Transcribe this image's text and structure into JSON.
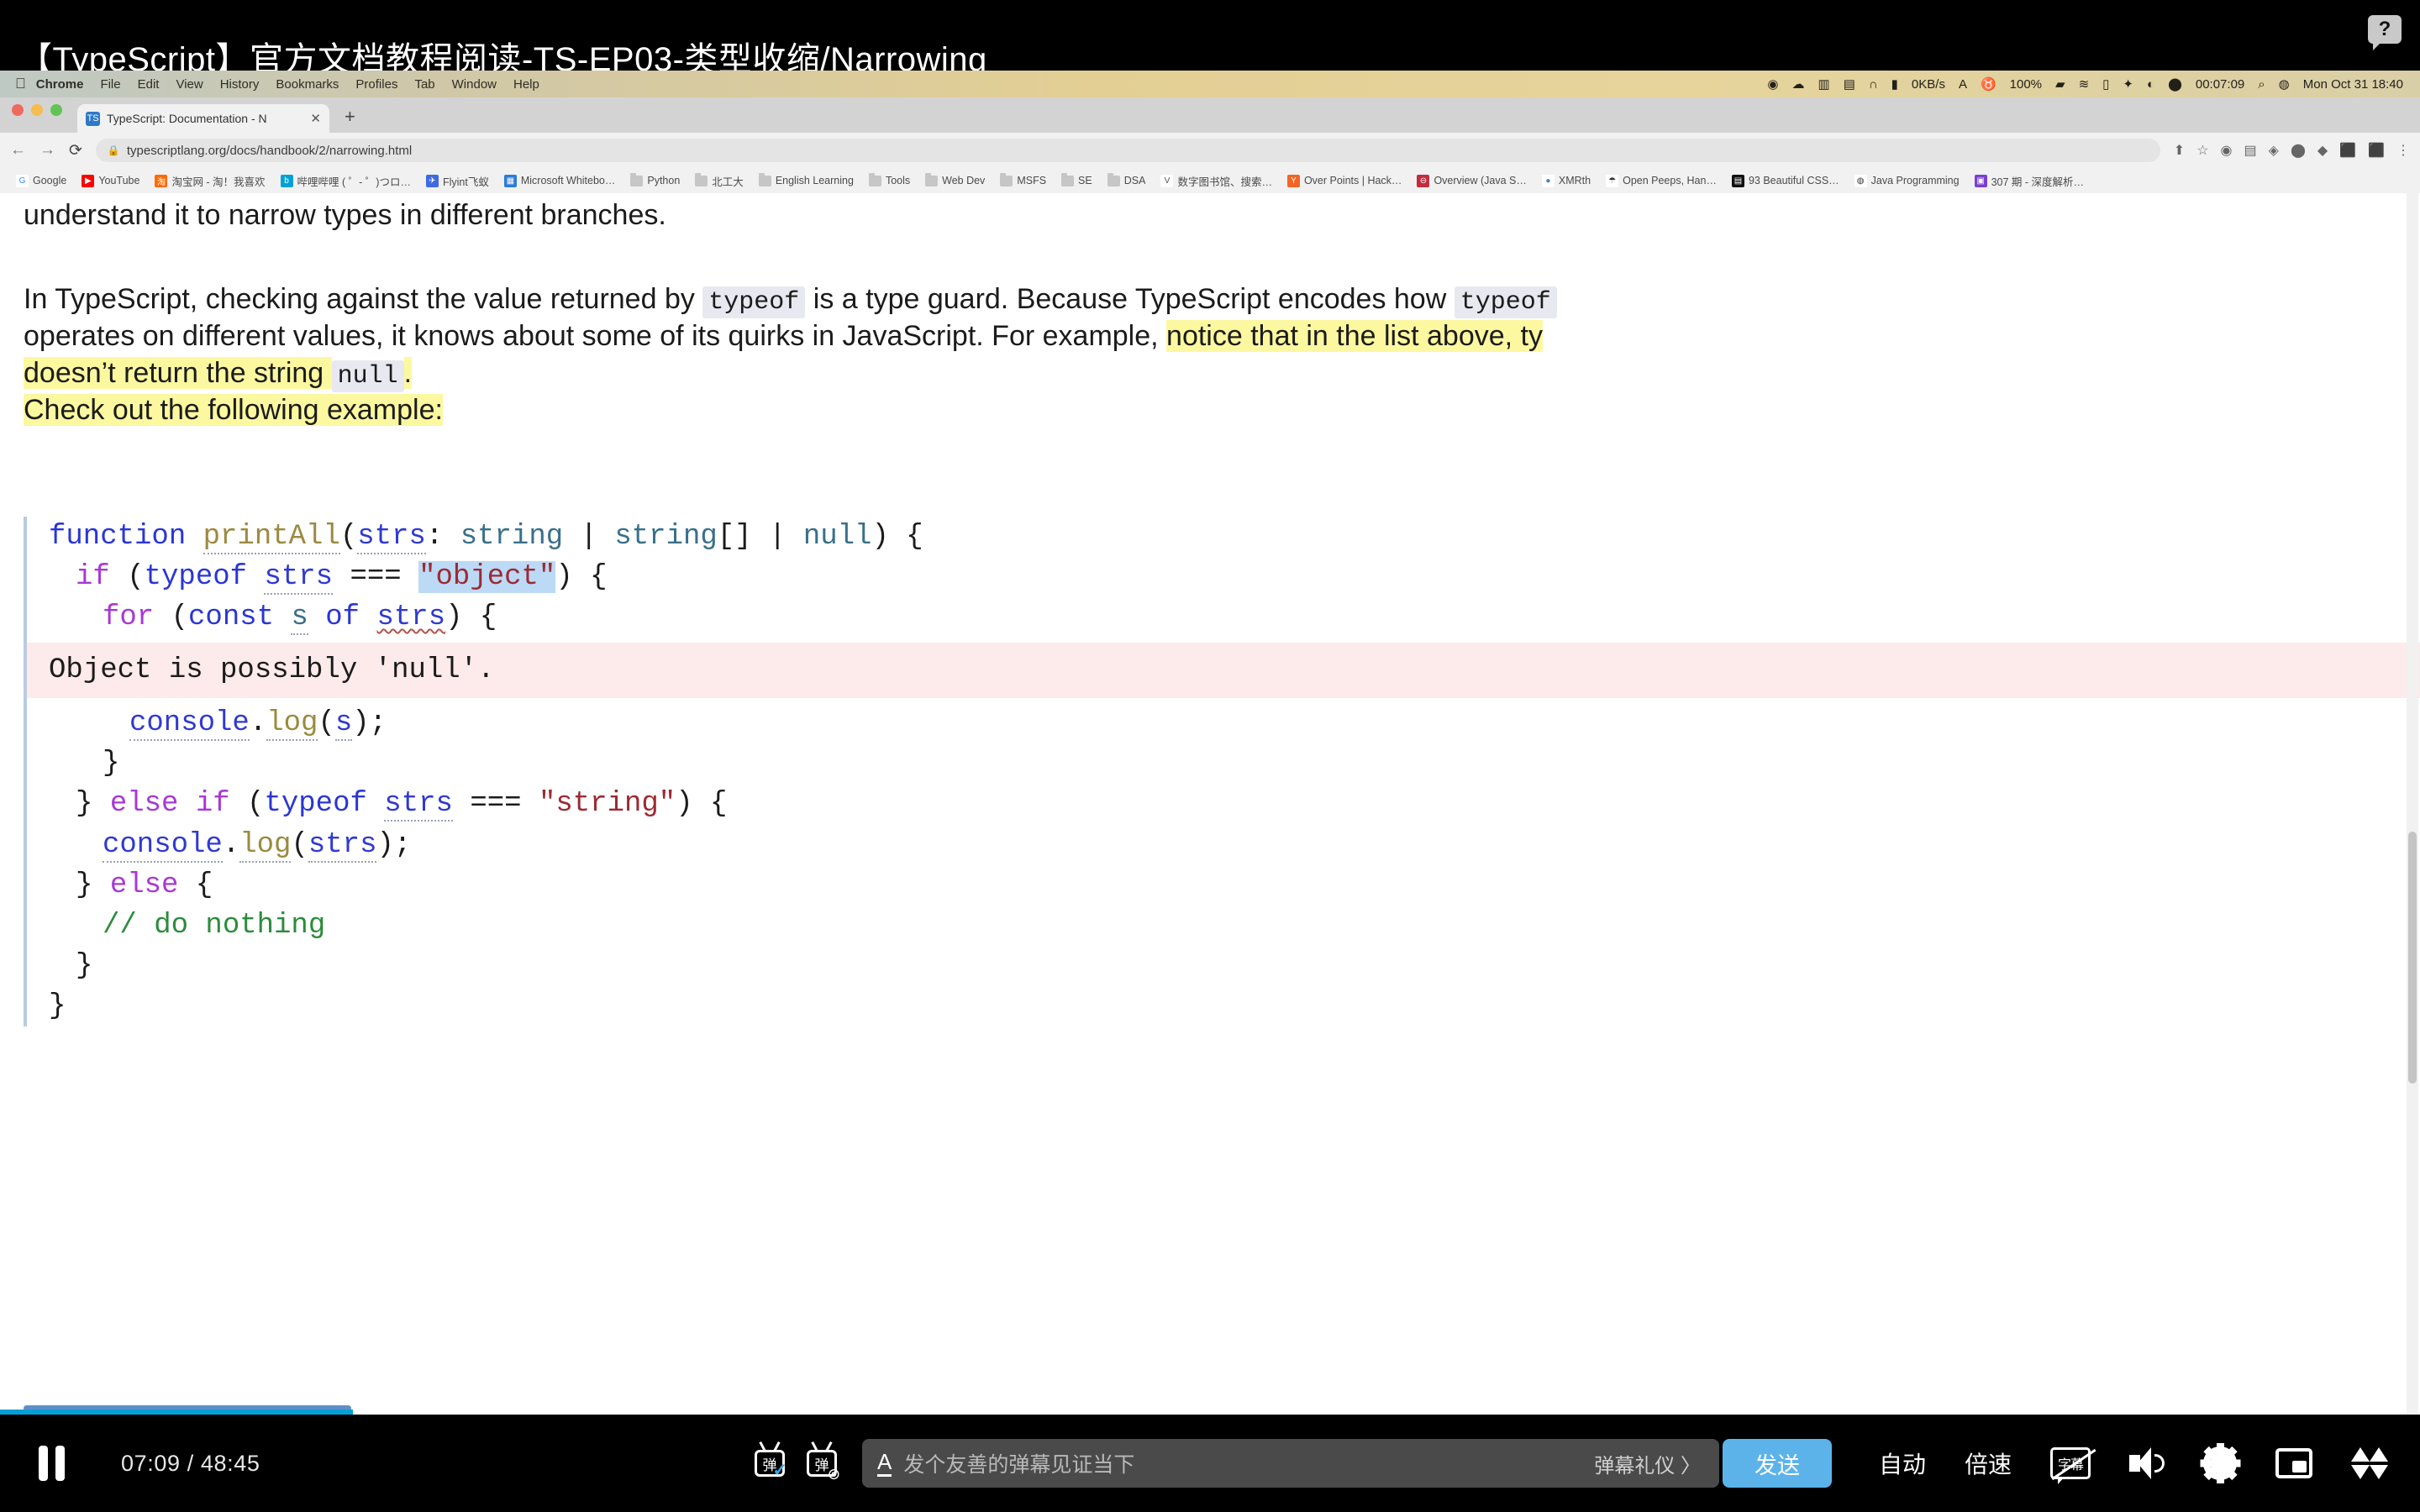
{
  "video": {
    "title": "【TypeScript】官方文档教程阅读-TS-EP03-类型收缩/Narrowing",
    "help_badge": "?",
    "current_time": "07:09",
    "duration": "48:45",
    "progress_percent": 14.6
  },
  "macos_menubar": {
    "apple": "",
    "items": [
      "Chrome",
      "File",
      "Edit",
      "View",
      "History",
      "Bookmarks",
      "Profiles",
      "Tab",
      "Window",
      "Help"
    ],
    "status_items": [
      {
        "name": "dropbox-icon",
        "glyph": "◉"
      },
      {
        "name": "cloud-icon",
        "glyph": "☁"
      },
      {
        "name": "equalizer-icon",
        "glyph": "▥"
      },
      {
        "name": "calendar-icon",
        "glyph": "▤"
      },
      {
        "name": "headphone-icon",
        "glyph": "∩"
      },
      {
        "name": "battery-monitor-icon",
        "glyph": "▮"
      },
      {
        "name": "network-speed-icon",
        "glyph": "0KB/s"
      },
      {
        "name": "a-letter-icon",
        "glyph": "A"
      },
      {
        "name": "fork-knife-icon",
        "glyph": "♉"
      },
      {
        "name": "battery-percent",
        "glyph": "100%"
      },
      {
        "name": "battery-icon",
        "glyph": "▰"
      },
      {
        "name": "wifi-icon",
        "glyph": "≋"
      },
      {
        "name": "control-center-icon",
        "glyph": "▯"
      },
      {
        "name": "bluetooth-icon",
        "glyph": "✦"
      },
      {
        "name": "moon-icon",
        "glyph": "◐"
      },
      {
        "name": "record-icon",
        "glyph": "⬤"
      },
      {
        "name": "screen-record-timer",
        "glyph": "00:07:09"
      },
      {
        "name": "spotlight-search-icon",
        "glyph": "⌕"
      },
      {
        "name": "siri-icon",
        "glyph": "◍"
      },
      {
        "name": "clock-datetime",
        "glyph": "Mon Oct 31  18:40"
      }
    ]
  },
  "browser": {
    "tab": {
      "favicon": "TS",
      "title": "TypeScript: Documentation - N",
      "close": "✕"
    },
    "new_tab_label": "+",
    "nav": {
      "back": "←",
      "forward": "→",
      "reload": "⟳"
    },
    "url": "typescriptlang.org/docs/handbook/2/narrowing.html",
    "lock_icon": "🔒",
    "omnibar_right": [
      "⬆",
      "☆",
      "◉",
      "▤",
      "◈",
      "⬤",
      "◆",
      "⬛",
      "⬛",
      "⋮"
    ],
    "bookmarks": [
      {
        "label": "Google",
        "icon": "G",
        "color": "#ffffff",
        "fg": "#4285f4"
      },
      {
        "label": "YouTube",
        "icon": "▶",
        "color": "#ff0000",
        "fg": "#ffffff"
      },
      {
        "label": "淘宝网 - 淘！我喜欢",
        "icon": "淘",
        "color": "#ff6a00",
        "fg": "#ffffff"
      },
      {
        "label": "哔哩哔哩 ( ゜- ゜)つロ…",
        "icon": "b",
        "color": "#00a1d6",
        "fg": "#ffffff"
      },
      {
        "label": "Flyint飞蚁",
        "icon": "✈",
        "color": "#3f6ae0",
        "fg": "#ffffff"
      },
      {
        "label": "Microsoft Whitebo…",
        "icon": "▦",
        "color": "#2d7cd6",
        "fg": "#ffffff"
      },
      {
        "label": "Python",
        "icon": "folder",
        "color": "",
        "fg": ""
      },
      {
        "label": "北工大",
        "icon": "folder",
        "color": "",
        "fg": ""
      },
      {
        "label": "English Learning",
        "icon": "folder",
        "color": "",
        "fg": ""
      },
      {
        "label": "Tools",
        "icon": "folder",
        "color": "",
        "fg": ""
      },
      {
        "label": "Web Dev",
        "icon": "folder",
        "color": "",
        "fg": ""
      },
      {
        "label": "MSFS",
        "icon": "folder",
        "color": "",
        "fg": ""
      },
      {
        "label": "SE",
        "icon": "folder",
        "color": "",
        "fg": ""
      },
      {
        "label": "DSA",
        "icon": "folder",
        "color": "",
        "fg": ""
      },
      {
        "label": "数字图书馆、搜索…",
        "icon": "V",
        "color": "#ffffff",
        "fg": "#555555"
      },
      {
        "label": "Over Points | Hack…",
        "icon": "Y",
        "color": "#f26522",
        "fg": "#ffffff"
      },
      {
        "label": "Overview (Java S…",
        "icon": "⊖",
        "color": "#c32c3e",
        "fg": "#ffffff"
      },
      {
        "label": "XMRth",
        "icon": "●",
        "color": "#ffffff",
        "fg": "#4a7fc1"
      },
      {
        "label": "Open Peeps, Han…",
        "icon": "☂",
        "color": "#ffffff",
        "fg": "#333333"
      },
      {
        "label": "93 Beautiful CSS…",
        "icon": "▤",
        "color": "#111111",
        "fg": "#ffffff"
      },
      {
        "label": "Java Programming",
        "icon": "◍",
        "color": "#ffffff",
        "fg": "#333333"
      },
      {
        "label": "307 期 - 深度解析…",
        "icon": "▣",
        "color": "#7b3fd1",
        "fg": "#ffffff"
      }
    ]
  },
  "page": {
    "paragraph_0_tail": "understand it to narrow types in different branches.",
    "p1_a": "In TypeScript, checking against the value returned by ",
    "p1_code1": "typeof",
    "p1_b": " is a type guard. Because TypeScript encodes how ",
    "p1_code2": "typeof",
    "p2_a": "operates on different values, it knows about some of its quirks in JavaScript. For example, ",
    "p2_hl": "notice that in the list above, ",
    "p2_tail": "ty",
    "p3_hl_a": "doesn’t return the string ",
    "p3_code": "null",
    "p3_hl_b": ".",
    "p4_hl": "Check out the following example:"
  },
  "code": {
    "lines": [
      {
        "id": "line-1",
        "tokens": [
          {
            "t": "function",
            "c": "k-fn"
          },
          {
            "t": " ",
            "c": "k-pun"
          },
          {
            "t": "printAll",
            "c": "k-name dotted"
          },
          {
            "t": "(",
            "c": "k-pun"
          },
          {
            "t": "strs",
            "c": "k-var dotted"
          },
          {
            "t": ":",
            "c": "k-pun"
          },
          {
            "t": " ",
            "c": "k-pun"
          },
          {
            "t": "string",
            "c": "k-type"
          },
          {
            "t": " | ",
            "c": "k-pun"
          },
          {
            "t": "string",
            "c": "k-type"
          },
          {
            "t": "[]",
            "c": "k-pun"
          },
          {
            "t": " | ",
            "c": "k-pun"
          },
          {
            "t": "null",
            "c": "k-type"
          },
          {
            "t": ") {",
            "c": "k-pun"
          }
        ]
      },
      {
        "id": "line-2",
        "indent": 1,
        "tokens": [
          {
            "t": "if",
            "c": "k-ctl"
          },
          {
            "t": " (",
            "c": "k-pun"
          },
          {
            "t": "typeof",
            "c": "k-fn"
          },
          {
            "t": " ",
            "c": "k-pun"
          },
          {
            "t": "strs",
            "c": "k-var dotted"
          },
          {
            "t": " === ",
            "c": "k-pun"
          },
          {
            "t": "\"object\"",
            "c": "k-str sel"
          },
          {
            "t": ") {",
            "c": "k-pun"
          }
        ]
      },
      {
        "id": "line-3",
        "indent": 2,
        "tokens": [
          {
            "t": "for",
            "c": "k-ctl"
          },
          {
            "t": " (",
            "c": "k-pun"
          },
          {
            "t": "const",
            "c": "k-fn"
          },
          {
            "t": " ",
            "c": "k-pun"
          },
          {
            "t": "s",
            "c": "k-type dotted"
          },
          {
            "t": " ",
            "c": "k-pun"
          },
          {
            "t": "of",
            "c": "k-fn"
          },
          {
            "t": " ",
            "c": "k-pun"
          },
          {
            "t": "strs",
            "c": "k-var squig"
          },
          {
            "t": ") {",
            "c": "k-pun"
          }
        ]
      }
    ],
    "error_message": "Object is possibly 'null'.",
    "lines_after": [
      {
        "id": "line-4",
        "indent": 3,
        "tokens": [
          {
            "t": "console",
            "c": "k-var dotted"
          },
          {
            "t": ".",
            "c": "k-pun"
          },
          {
            "t": "log",
            "c": "k-name dotted"
          },
          {
            "t": "(",
            "c": "k-pun"
          },
          {
            "t": "s",
            "c": "k-var dotted"
          },
          {
            "t": ");",
            "c": "k-pun"
          }
        ]
      },
      {
        "id": "line-5",
        "indent": 2,
        "tokens": [
          {
            "t": "}",
            "c": "k-pun"
          }
        ]
      },
      {
        "id": "line-6",
        "indent": 1,
        "tokens": [
          {
            "t": "} ",
            "c": "k-pun"
          },
          {
            "t": "else",
            "c": "k-ctl"
          },
          {
            "t": " ",
            "c": "k-pun"
          },
          {
            "t": "if",
            "c": "k-ctl"
          },
          {
            "t": " (",
            "c": "k-pun"
          },
          {
            "t": "typeof",
            "c": "k-fn"
          },
          {
            "t": " ",
            "c": "k-pun"
          },
          {
            "t": "strs",
            "c": "k-var dotted"
          },
          {
            "t": " === ",
            "c": "k-pun"
          },
          {
            "t": "\"string\"",
            "c": "k-str"
          },
          {
            "t": ") {",
            "c": "k-pun"
          }
        ]
      },
      {
        "id": "line-7",
        "indent": 2,
        "tokens": [
          {
            "t": "console",
            "c": "k-var dotted"
          },
          {
            "t": ".",
            "c": "k-pun"
          },
          {
            "t": "log",
            "c": "k-name dotted"
          },
          {
            "t": "(",
            "c": "k-pun"
          },
          {
            "t": "strs",
            "c": "k-var dotted"
          },
          {
            "t": ");",
            "c": "k-pun"
          }
        ]
      },
      {
        "id": "line-8",
        "indent": 1,
        "tokens": [
          {
            "t": "} ",
            "c": "k-pun"
          },
          {
            "t": "else",
            "c": "k-ctl"
          },
          {
            "t": " {",
            "c": "k-pun"
          }
        ]
      },
      {
        "id": "line-9",
        "indent": 2,
        "tokens": [
          {
            "t": "// do nothing",
            "c": "k-cmt"
          }
        ]
      },
      {
        "id": "line-10",
        "indent": 1,
        "tokens": [
          {
            "t": "}",
            "c": "k-pun"
          }
        ]
      },
      {
        "id": "line-11",
        "indent": 0,
        "tokens": [
          {
            "t": "}",
            "c": "k-pun"
          }
        ]
      }
    ]
  },
  "player": {
    "play_state": "paused",
    "time_current": "07:09",
    "time_sep": "/",
    "time_total": "48:45",
    "danmaku_toggle": "弹",
    "danmaku_settings": "弹",
    "input_font_icon": "A",
    "input_placeholder": "发个友善的弹幕见证当下",
    "etiquette_label": "弹幕礼仪 〉",
    "send_label": "发送",
    "quality_label": "自动",
    "speed_label": "倍速",
    "subtitle_label": "字幕",
    "accent_color": "#00a1d6",
    "send_button_color": "#5bb3e9"
  }
}
